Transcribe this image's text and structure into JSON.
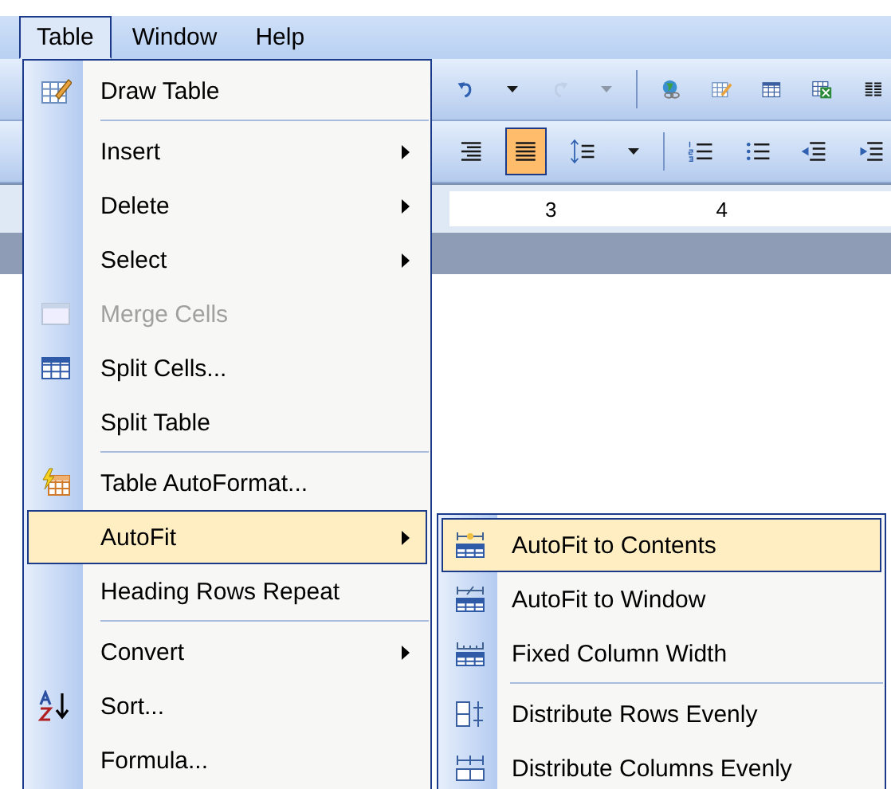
{
  "menubar": [
    {
      "label": "Table",
      "selected": true
    },
    {
      "label": "Window",
      "selected": false
    },
    {
      "label": "Help",
      "selected": false
    }
  ],
  "toolbar_1": [
    {
      "kind": "undo",
      "disabled": false,
      "separator_after": false
    },
    {
      "kind": "dropdown",
      "disabled": false,
      "separator_after": false
    },
    {
      "kind": "redo",
      "disabled": true,
      "separator_after": false
    },
    {
      "kind": "dropdown",
      "disabled": true,
      "separator_after": true
    },
    {
      "kind": "hyperlink",
      "disabled": false,
      "separator_after": false
    },
    {
      "kind": "draw-table",
      "disabled": false,
      "separator_after": false
    },
    {
      "kind": "table",
      "disabled": false,
      "separator_after": false
    },
    {
      "kind": "spreadsheet",
      "disabled": false,
      "separator_after": false
    },
    {
      "kind": "columns",
      "disabled": false,
      "separator_after": false
    }
  ],
  "toolbar_2": [
    {
      "kind": "align-right",
      "selected": false,
      "separator_after": false
    },
    {
      "kind": "justify",
      "selected": true,
      "separator_after": false
    },
    {
      "kind": "line-spacing",
      "selected": false,
      "separator_after": false
    },
    {
      "kind": "dropdown",
      "selected": false,
      "separator_after": true
    },
    {
      "kind": "numbering",
      "selected": false,
      "separator_after": false
    },
    {
      "kind": "bullets",
      "selected": false,
      "separator_after": false
    },
    {
      "kind": "outdent",
      "selected": false,
      "separator_after": false
    },
    {
      "kind": "indent",
      "selected": false,
      "separator_after": false
    }
  ],
  "ruler": {
    "marks": [
      "3",
      "4"
    ]
  },
  "menu": [
    {
      "label": "Draw Table",
      "submenu": false,
      "disabled": false,
      "selected": false,
      "separator_after": true
    },
    {
      "label": "Insert",
      "submenu": true,
      "disabled": false,
      "selected": false,
      "separator_after": false
    },
    {
      "label": "Delete",
      "submenu": true,
      "disabled": false,
      "selected": false,
      "separator_after": false
    },
    {
      "label": "Select",
      "submenu": true,
      "disabled": false,
      "selected": false,
      "separator_after": false
    },
    {
      "label": "Merge Cells",
      "submenu": false,
      "disabled": true,
      "selected": false,
      "separator_after": false
    },
    {
      "label": "Split Cells...",
      "submenu": false,
      "disabled": false,
      "selected": false,
      "separator_after": false
    },
    {
      "label": "Split Table",
      "submenu": false,
      "disabled": false,
      "selected": false,
      "separator_after": true
    },
    {
      "label": "Table AutoFormat...",
      "submenu": false,
      "disabled": false,
      "selected": false,
      "separator_after": false
    },
    {
      "label": "AutoFit",
      "submenu": true,
      "disabled": false,
      "selected": true,
      "separator_after": false
    },
    {
      "label": "Heading Rows Repeat",
      "submenu": false,
      "disabled": false,
      "selected": false,
      "separator_after": true
    },
    {
      "label": "Convert",
      "submenu": true,
      "disabled": false,
      "selected": false,
      "separator_after": false
    },
    {
      "label": "Sort...",
      "submenu": false,
      "disabled": false,
      "selected": false,
      "separator_after": false
    },
    {
      "label": "Formula...",
      "submenu": false,
      "disabled": false,
      "selected": false,
      "separator_after": false
    }
  ],
  "submenu": [
    {
      "label": "AutoFit to Contents",
      "selected": true,
      "separator_after": false
    },
    {
      "label": "AutoFit to Window",
      "selected": false,
      "separator_after": false
    },
    {
      "label": "Fixed Column Width",
      "selected": false,
      "separator_after": true
    },
    {
      "label": "Distribute Rows Evenly",
      "selected": false,
      "separator_after": false
    },
    {
      "label": "Distribute Columns Evenly",
      "selected": false,
      "separator_after": false
    }
  ]
}
